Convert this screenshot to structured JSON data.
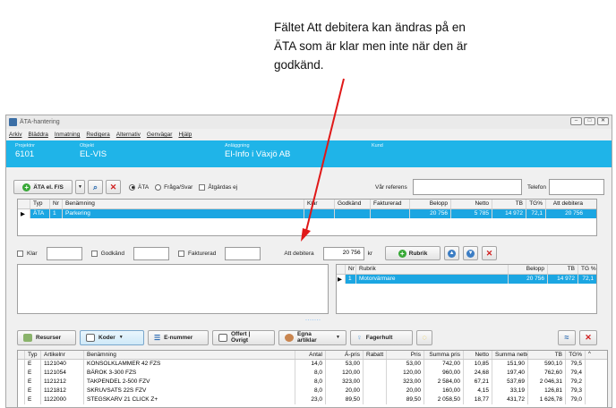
{
  "annotation": {
    "line1": "Fältet Att debitera kan ändras på en",
    "line2": "ÄTA som är klar men inte när den är",
    "line3": "godkänd."
  },
  "window": {
    "title": "ÄTA-hantering",
    "menu": [
      "Arkiv",
      "Bläddra",
      "Inmatning",
      "Redigera",
      "Alternativ",
      "Genvägar",
      "Hjälp"
    ]
  },
  "header": {
    "projektnr_label": "Projektnr",
    "projektnr": "6101",
    "objekt_label": "Objekt",
    "objekt": "EL-VIS",
    "anlaggning_label": "Anläggning",
    "anlaggning": "El-Info i Växjö AB",
    "kund_label": "Kund",
    "kund": ""
  },
  "toolbar": {
    "ata_button": "ÄTA el. F/S",
    "radio_ata": "ÄTA",
    "radio_fraga": "Fråga/Svar",
    "check_atgardas": "Åtgärdas ej",
    "var_referens_label": "Vår referens",
    "telefon_label": "Telefon"
  },
  "ata_grid": {
    "columns": [
      "Typ",
      "Nr",
      "Benämning",
      "Klar",
      "Godkänd",
      "Fakturerad",
      "Belopp",
      "Netto",
      "TB",
      "TG%",
      "Att debitera"
    ],
    "rows": [
      {
        "typ": "ÄTA",
        "nr": "1",
        "benamning": "Parkering",
        "belopp": "20 756",
        "netto": "5 785",
        "tb": "14 972",
        "tg": "72,1",
        "att_debitera": "20 756"
      }
    ]
  },
  "status_row": {
    "klar": "Klar",
    "godkand": "Godkänd",
    "fakturerad": "Fakturerad",
    "att_debitera_label": "Att debitera",
    "att_debitera_value": "20 756",
    "unit": "kr",
    "rubrik_button": "Rubrik"
  },
  "rubrik_grid": {
    "columns": [
      "Nr",
      "Rubrik",
      "Belopp",
      "TB",
      "TG %"
    ],
    "rows": [
      {
        "nr": "1",
        "rubrik": "Motorvärmare",
        "belopp": "20 756",
        "tb": "14 972",
        "tg": "72,1"
      }
    ]
  },
  "toolbar2": {
    "resurser": "Resurser",
    "koder": "Koder",
    "e_nummer": "E-nummer",
    "offert": "Offert | Övrigt",
    "egna": "Egna artiklar",
    "fagerhult": "Fagerhult"
  },
  "article_grid": {
    "columns": [
      "Typ",
      "Artikelnr",
      "Benämning",
      "Antal",
      "Á-pris",
      "Rabatt",
      "Pris",
      "Summa pris",
      "Netto",
      "Summa netto",
      "TB",
      "TG%"
    ],
    "rows": [
      {
        "typ": "E",
        "artnr": "1121040",
        "ben": "KONSOLKLAMMER 42 FZS",
        "antal": "14,0",
        "apris": "53,00",
        "rabatt": "",
        "pris": "53,00",
        "summa": "742,00",
        "netto": "10,85",
        "snetto": "151,90",
        "tb": "590,10",
        "tg": "79,5"
      },
      {
        "typ": "E",
        "artnr": "1121054",
        "ben": "BÄROK 3-300 FZS",
        "antal": "8,0",
        "apris": "120,00",
        "rabatt": "",
        "pris": "120,00",
        "summa": "960,00",
        "netto": "24,68",
        "snetto": "197,40",
        "tb": "762,60",
        "tg": "79,4"
      },
      {
        "typ": "E",
        "artnr": "1121212",
        "ben": "TAKPENDEL 2-500 FZV",
        "antal": "8,0",
        "apris": "323,00",
        "rabatt": "",
        "pris": "323,00",
        "summa": "2 584,00",
        "netto": "67,21",
        "snetto": "537,69",
        "tb": "2 046,31",
        "tg": "79,2"
      },
      {
        "typ": "E",
        "artnr": "1121812",
        "ben": "SKRUVSATS 22S FZV",
        "antal": "8,0",
        "apris": "20,00",
        "rabatt": "",
        "pris": "20,00",
        "summa": "160,00",
        "netto": "4,15",
        "snetto": "33,19",
        "tb": "126,81",
        "tg": "79,3"
      },
      {
        "typ": "E",
        "artnr": "1122000",
        "ben": "STEGSKARV 21 CLICK Z+",
        "antal": "23,0",
        "apris": "89,50",
        "rabatt": "",
        "pris": "89,50",
        "summa": "2 058,50",
        "netto": "18,77",
        "snetto": "431,72",
        "tb": "1 626,78",
        "tg": "79,0"
      }
    ]
  }
}
